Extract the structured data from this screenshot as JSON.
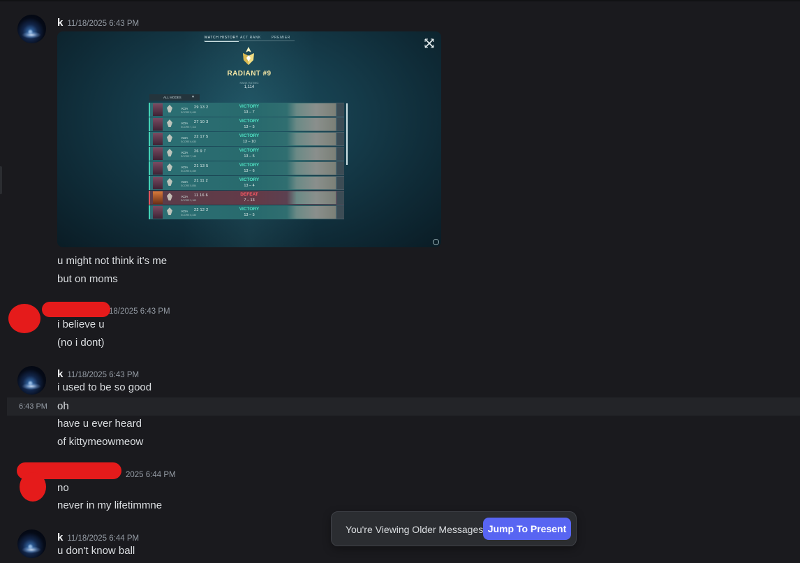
{
  "colors": {
    "background": "#1a1a1e",
    "accent": "#5865f2",
    "victory": "#4fe3c4",
    "defeat": "#ff5a66",
    "redaction": "#e51b1b"
  },
  "messages": [
    {
      "username": "k",
      "timestamp": "11/18/2025 6:43 PM",
      "lines": [
        "u might not think it's me",
        "but on moms"
      ],
      "embed": {
        "tabs": [
          "MATCH HISTORY",
          "ACT RANK",
          "PREMIER"
        ],
        "rank_title": "RADIANT #9",
        "rating_label": "RANK RATING",
        "rating_value": "1,114",
        "mode_filter": "ALL MODES",
        "matches": [
          {
            "kda_label": "KDA",
            "kda": "29 13 2",
            "score": "SCORE 5,490",
            "result": "VICTORY",
            "rounds": "13 – 7"
          },
          {
            "kda_label": "KDA",
            "kda": "27 10 3",
            "score": "SCORE 7,114",
            "result": "VICTORY",
            "rounds": "13 – 5"
          },
          {
            "kda_label": "KDA",
            "kda": "22 17 5",
            "score": "SCORE 6,630",
            "result": "VICTORY",
            "rounds": "13 – 10"
          },
          {
            "kda_label": "KDA",
            "kda": "26 9 7",
            "score": "SCORE 7,145",
            "result": "VICTORY",
            "rounds": "13 – 5"
          },
          {
            "kda_label": "KDA",
            "kda": "21 13 5",
            "score": "SCORE 6,459",
            "result": "VICTORY",
            "rounds": "13 – 6"
          },
          {
            "kda_label": "KDA",
            "kda": "21 11 2",
            "score": "SCORE 5,854",
            "result": "VICTORY",
            "rounds": "13 – 4"
          },
          {
            "kda_label": "KDA",
            "kda": "11 16 6",
            "score": "SCORE 3,163",
            "result": "DEFEAT",
            "rounds": "7 – 13"
          },
          {
            "kda_label": "KDA",
            "kda": "22 12 2",
            "score": "SCORE 6,330",
            "result": "VICTORY",
            "rounds": "13 – 5"
          }
        ]
      }
    },
    {
      "username": "",
      "timestamp": "18/2025 6:43 PM",
      "lines": [
        "i believe u",
        "(no i dont)"
      ]
    },
    {
      "username": "k",
      "timestamp": "11/18/2025 6:43 PM",
      "lines": [
        "i used to be so good"
      ],
      "continuation": {
        "time": "6:43 PM",
        "lines": [
          "oh",
          "have u ever heard",
          "of kittymeowmeow"
        ]
      }
    },
    {
      "username": "",
      "timestamp": "2025 6:44 PM",
      "lines": [
        "no",
        "never in my lifetimmne"
      ]
    },
    {
      "username": "k",
      "timestamp": "11/18/2025 6:44 PM",
      "lines": [
        "u don't know ball"
      ]
    }
  ],
  "jump_bar": {
    "text": "You're Viewing Older Messages",
    "button": "Jump To Present"
  }
}
